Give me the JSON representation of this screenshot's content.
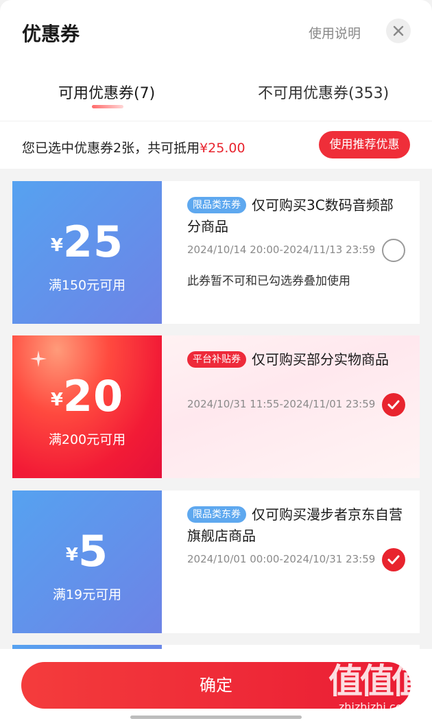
{
  "header": {
    "title": "优惠券",
    "help": "使用说明"
  },
  "tabs": [
    {
      "label": "可用优惠券(7)",
      "active": true
    },
    {
      "label": "不可用优惠券(353)",
      "active": false
    }
  ],
  "summary": {
    "text": "您已选中优惠券2张，共可抵用",
    "amount": "¥25.00",
    "button": "使用推荐优惠"
  },
  "coupons": [
    {
      "currency": "¥",
      "amount": "25",
      "condition": "满150元可用",
      "tag": "限品类东券",
      "description": "仅可购买3C数码音频部分商品",
      "date": "2024/10/14 20:00-2024/11/13 23:59",
      "note": "此券暂不可和已勾选券叠加使用",
      "selected": false,
      "theme": "blue"
    },
    {
      "currency": "¥",
      "amount": "20",
      "condition": "满200元可用",
      "tag": "平台补贴券",
      "description": "仅可购买部分实物商品",
      "date": "2024/10/31 11:55-2024/11/01 23:59",
      "selected": true,
      "theme": "red"
    },
    {
      "currency": "¥",
      "amount": "5",
      "condition": "满19元可用",
      "tag": "限品类东券",
      "description": "仅可购买漫步者京东自营旗舰店商品",
      "date": "2024/10/01 00:00-2024/10/31 23:59",
      "selected": true,
      "theme": "blue"
    }
  ],
  "footer": {
    "confirm": "确定"
  },
  "watermark": {
    "main": "值值值",
    "site": "zhizhizhi.com"
  },
  "colors": {
    "accent": "#e8242e",
    "blue_coupon": "#5b93ec",
    "red_coupon": "#f21b36"
  },
  "icons": [
    "close-icon",
    "check-icon"
  ]
}
